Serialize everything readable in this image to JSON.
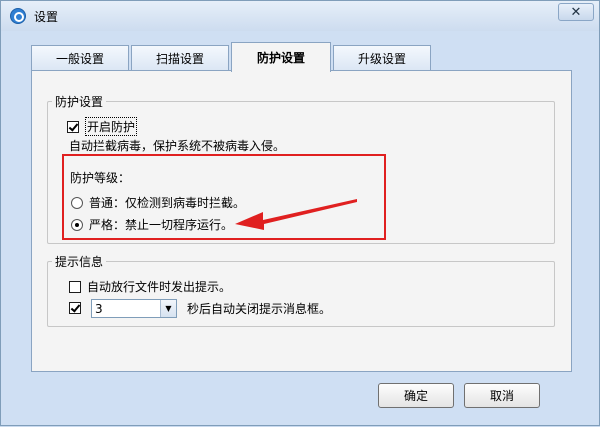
{
  "window": {
    "title": "设置",
    "close_label": "✕"
  },
  "tabs": [
    {
      "label": "一般设置",
      "active": false
    },
    {
      "label": "扫描设置",
      "active": false
    },
    {
      "label": "防护设置",
      "active": true
    },
    {
      "label": "升级设置",
      "active": false
    }
  ],
  "protection": {
    "group_title": "防护设置",
    "enable_label": "开启防护",
    "enable_checked": true,
    "description": "自动拦截病毒，保护系统不被病毒入侵。",
    "level_title": "防护等级：",
    "levels": [
      {
        "label": "普通：仅检测到病毒时拦截。",
        "selected": false
      },
      {
        "label": "严格：禁止一切程序运行。",
        "selected": true
      }
    ]
  },
  "notify": {
    "group_title": "提示信息",
    "release_label": "自动放行文件时发出提示。",
    "release_checked": false,
    "autoclose_checked": true,
    "seconds_value": "3",
    "autoclose_label": "秒后自动关闭提示消息框。"
  },
  "buttons": {
    "ok": "确定",
    "cancel": "取消"
  },
  "annotation_color": "#e02020"
}
